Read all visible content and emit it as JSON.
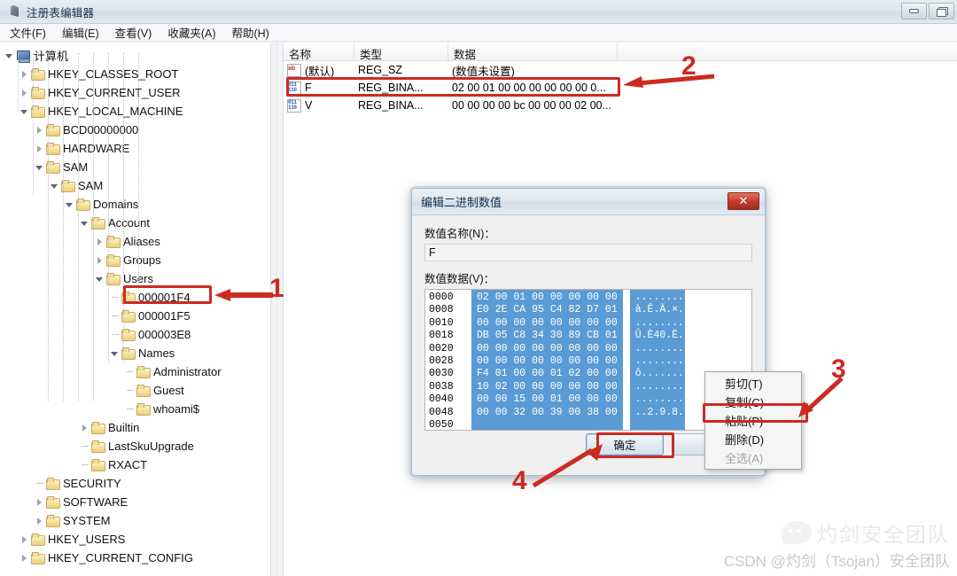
{
  "window": {
    "title": "注册表编辑器",
    "icon": "registry-icon",
    "minimize_label": "最小化",
    "maximize_label": "最大化"
  },
  "menubar": {
    "items": [
      {
        "label": "文件(F)",
        "name": "menu-file"
      },
      {
        "label": "编辑(E)",
        "name": "menu-edit"
      },
      {
        "label": "查看(V)",
        "name": "menu-view"
      },
      {
        "label": "收藏夹(A)",
        "name": "menu-favorites"
      },
      {
        "label": "帮助(H)",
        "name": "menu-help"
      }
    ]
  },
  "tree": {
    "nodes": [
      {
        "label": "计算机",
        "depth": 0,
        "state": "open",
        "icon": "computer-icon"
      },
      {
        "label": "HKEY_CLASSES_ROOT",
        "depth": 1,
        "state": "closed",
        "icon": "folder-icon"
      },
      {
        "label": "HKEY_CURRENT_USER",
        "depth": 1,
        "state": "closed",
        "icon": "folder-icon"
      },
      {
        "label": "HKEY_LOCAL_MACHINE",
        "depth": 1,
        "state": "open",
        "icon": "folder-icon"
      },
      {
        "label": "BCD00000000",
        "depth": 2,
        "state": "closed",
        "icon": "folder-icon"
      },
      {
        "label": "HARDWARE",
        "depth": 2,
        "state": "closed",
        "icon": "folder-icon"
      },
      {
        "label": "SAM",
        "depth": 2,
        "state": "open",
        "icon": "folder-icon"
      },
      {
        "label": "SAM",
        "depth": 3,
        "state": "open",
        "icon": "folder-icon"
      },
      {
        "label": "Domains",
        "depth": 4,
        "state": "open",
        "icon": "folder-icon"
      },
      {
        "label": "Account",
        "depth": 5,
        "state": "open",
        "icon": "folder-icon"
      },
      {
        "label": "Aliases",
        "depth": 6,
        "state": "closed",
        "icon": "folder-icon"
      },
      {
        "label": "Groups",
        "depth": 6,
        "state": "closed",
        "icon": "folder-icon"
      },
      {
        "label": "Users",
        "depth": 6,
        "state": "open",
        "icon": "folder-icon"
      },
      {
        "label": "000001F4",
        "depth": 7,
        "state": "leaf",
        "icon": "folder-icon"
      },
      {
        "label": "000001F5",
        "depth": 7,
        "state": "leaf",
        "icon": "folder-icon"
      },
      {
        "label": "000003E8",
        "depth": 7,
        "state": "leaf",
        "icon": "folder-icon",
        "highlighted": true
      },
      {
        "label": "Names",
        "depth": 7,
        "state": "open",
        "icon": "folder-icon"
      },
      {
        "label": "Administrator",
        "depth": 8,
        "state": "leaf",
        "icon": "folder-icon"
      },
      {
        "label": "Guest",
        "depth": 8,
        "state": "leaf",
        "icon": "folder-icon"
      },
      {
        "label": "whoami$",
        "depth": 8,
        "state": "leaf",
        "icon": "folder-icon"
      },
      {
        "label": "Builtin",
        "depth": 5,
        "state": "closed",
        "icon": "folder-icon"
      },
      {
        "label": "LastSkuUpgrade",
        "depth": 5,
        "state": "leaf",
        "icon": "folder-icon"
      },
      {
        "label": "RXACT",
        "depth": 5,
        "state": "leaf",
        "icon": "folder-icon"
      },
      {
        "label": "SECURITY",
        "depth": 2,
        "state": "leaf",
        "icon": "folder-icon"
      },
      {
        "label": "SOFTWARE",
        "depth": 2,
        "state": "closed",
        "icon": "folder-icon"
      },
      {
        "label": "SYSTEM",
        "depth": 2,
        "state": "closed",
        "icon": "folder-icon"
      },
      {
        "label": "HKEY_USERS",
        "depth": 1,
        "state": "closed",
        "icon": "folder-icon"
      },
      {
        "label": "HKEY_CURRENT_CONFIG",
        "depth": 1,
        "state": "closed",
        "icon": "folder-icon"
      }
    ]
  },
  "list": {
    "columns": [
      "名称",
      "类型",
      "数据"
    ],
    "rows": [
      {
        "icon": "string-value-icon",
        "name": "(默认)",
        "type": "REG_SZ",
        "data": "(数值未设置)"
      },
      {
        "icon": "binary-value-icon",
        "name": "F",
        "type": "REG_BINA...",
        "data": "02 00 01 00 00 00 00 00 00 0...",
        "highlighted": true
      },
      {
        "icon": "binary-value-icon",
        "name": "V",
        "type": "REG_BINA...",
        "data": "00 00 00 00 bc 00 00 00 02 00..."
      }
    ]
  },
  "dialog": {
    "title": "编辑二进制数值",
    "close_label": "✕",
    "name_label": "数值名称(N)：",
    "name_value": "F",
    "data_label": "数值数据(V)：",
    "hex_rows": [
      {
        "offset": "0000",
        "bytes": "02 00 01 00 00 00 00 00",
        "ascii": "........"
      },
      {
        "offset": "0008",
        "bytes": "E0 2E CA 95 C4 82 D7 01",
        "ascii": "à.Ê.Ä.×."
      },
      {
        "offset": "0010",
        "bytes": "00 00 00 00 00 00 00 00",
        "ascii": "........"
      },
      {
        "offset": "0018",
        "bytes": "DB 05 C8 34 30 89 CB 01",
        "ascii": "Û.È40.Ë."
      },
      {
        "offset": "0020",
        "bytes": "00 00 00 00 00 00 00 00",
        "ascii": "........"
      },
      {
        "offset": "0028",
        "bytes": "00 00 00 00 00 00 00 00",
        "ascii": "........"
      },
      {
        "offset": "0030",
        "bytes": "F4 01 00 00 01 02 00 00",
        "ascii": "ô......."
      },
      {
        "offset": "0038",
        "bytes": "10 02 00 00 00 00 00 00",
        "ascii": "........"
      },
      {
        "offset": "0040",
        "bytes": "00 00 15 00 01 00 00 00",
        "ascii": "........"
      },
      {
        "offset": "0048",
        "bytes": "00 00 32 00 39 00 38 00",
        "ascii": "..2.9.8."
      },
      {
        "offset": "0050",
        "bytes": "",
        "ascii": ""
      }
    ],
    "ok_label": "确定",
    "cancel_label": ""
  },
  "context_menu": {
    "items": [
      {
        "label": "剪切(T)",
        "name": "ctx-cut",
        "disabled": false
      },
      {
        "label": "复制(C)",
        "name": "ctx-copy",
        "disabled": false
      },
      {
        "label": "粘贴(P)",
        "name": "ctx-paste",
        "disabled": false,
        "highlighted": true
      },
      {
        "label": "删除(D)",
        "name": "ctx-delete",
        "disabled": false
      },
      {
        "label": "全选(A)",
        "name": "ctx-selectall",
        "disabled": true
      }
    ]
  },
  "annotations": {
    "color": "#cc2a22",
    "steps": [
      {
        "number": "1",
        "target": "tree-node-000003E8"
      },
      {
        "number": "2",
        "target": "list-row-F"
      },
      {
        "number": "3",
        "target": "ctx-paste"
      },
      {
        "number": "4",
        "target": "dialog-ok-button"
      }
    ]
  },
  "watermark": {
    "logo_text": "灼剑安全团队",
    "credit": "CSDN @灼剑（Tsojan）安全团队"
  }
}
